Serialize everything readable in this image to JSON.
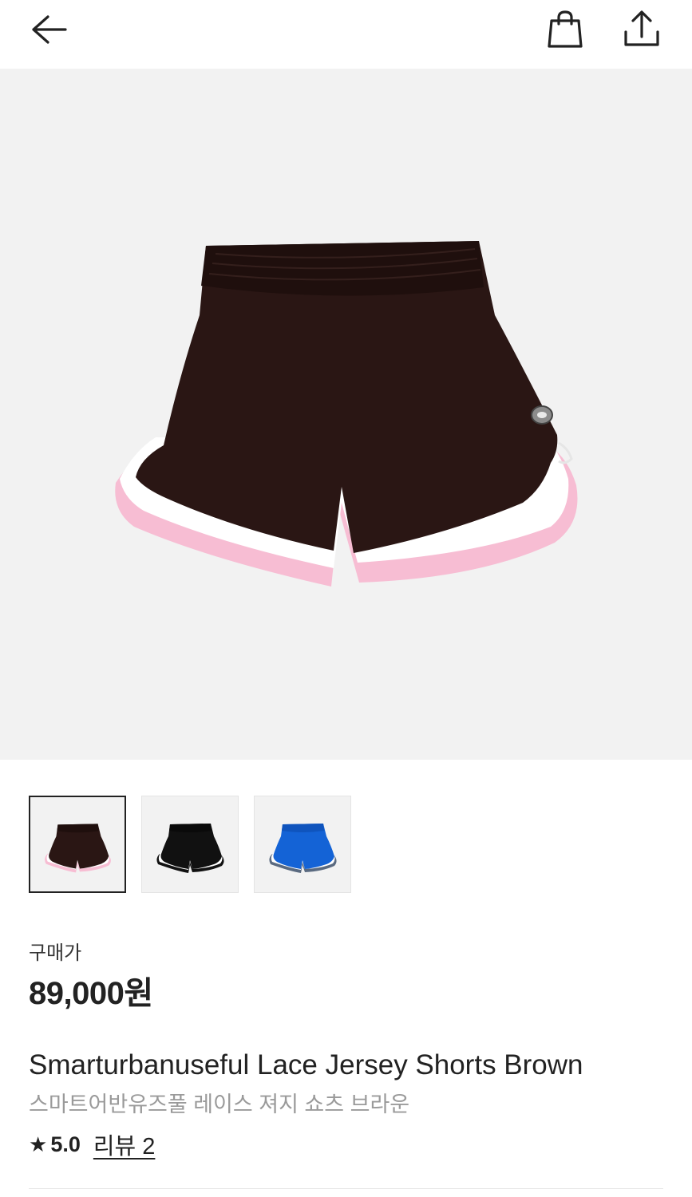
{
  "header": {
    "back_icon": "arrow-left-icon",
    "bag_icon": "shopping-bag-icon",
    "share_icon": "share-upload-icon"
  },
  "product": {
    "price_label": "구매가",
    "price": "89,000원",
    "title_en": "Smarturbanuseful Lace Jersey Shorts Brown",
    "title_ko": "스마트어반유즈풀 레이스 져지 쇼츠 브라운",
    "rating_icon": "star-icon",
    "rating": "5.0",
    "reviews_link": "리뷰 2"
  },
  "gallery": {
    "selected_index": 0,
    "thumbnails": [
      {
        "color": "brown",
        "main": "#2a1614",
        "trim1": "#ffffff",
        "trim2": "#f5b8cf"
      },
      {
        "color": "black",
        "main": "#111111",
        "trim1": "#ffffff",
        "trim2": "#111111"
      },
      {
        "color": "blue",
        "main": "#1463d6",
        "trim1": "#ffffff",
        "trim2": "#5a6a80"
      }
    ]
  },
  "colors": {
    "background": "#ffffff",
    "image_bg": "#f2f2f2",
    "text": "#222222",
    "subtext": "#9a9a9a"
  }
}
